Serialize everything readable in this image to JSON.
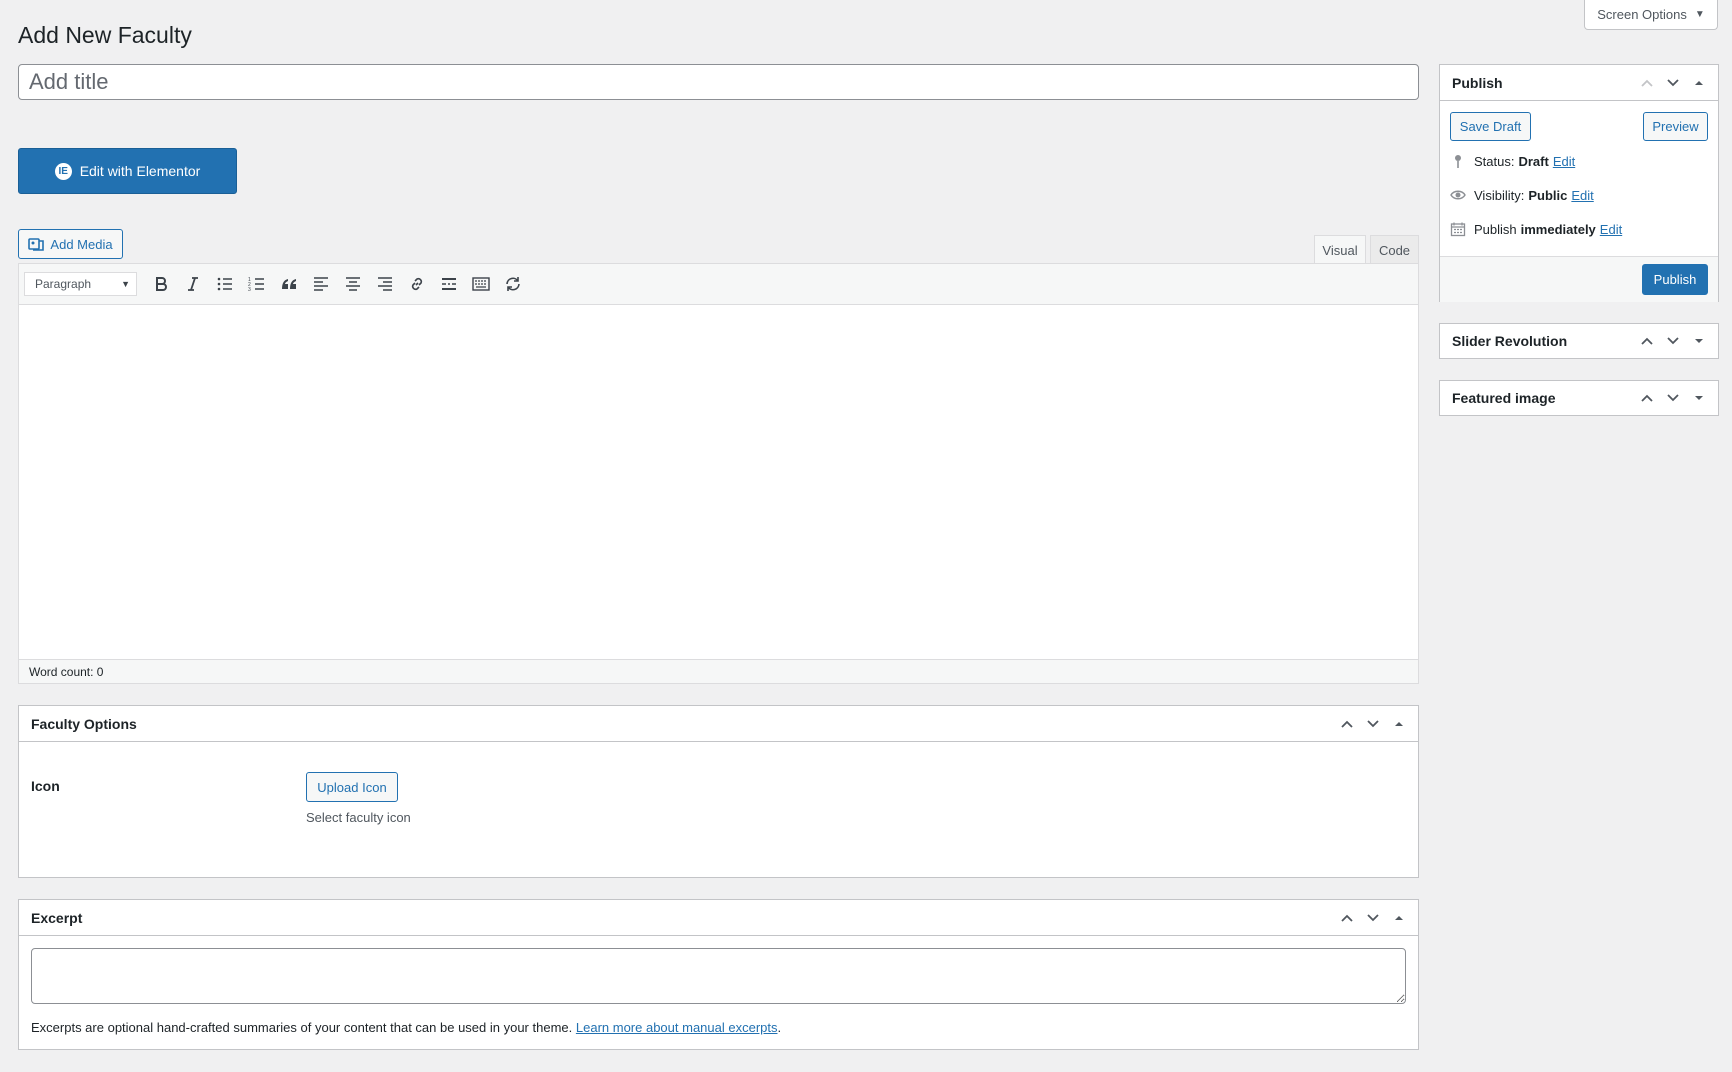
{
  "screen_options": {
    "label": "Screen Options"
  },
  "page": {
    "title": "Add New Faculty"
  },
  "title_field": {
    "placeholder": "Add title",
    "value": ""
  },
  "elementor": {
    "label": "Edit with Elementor",
    "icon": "elementor-icon"
  },
  "media": {
    "add_media_label": "Add Media"
  },
  "editor": {
    "tabs": {
      "visual": "Visual",
      "code": "Code"
    },
    "format_select": "Paragraph",
    "word_count": "Word count: 0"
  },
  "faculty_options": {
    "title": "Faculty Options",
    "icon_label": "Icon",
    "upload_button": "Upload Icon",
    "description": "Select faculty icon"
  },
  "excerpt": {
    "title": "Excerpt",
    "help_text": "Excerpts are optional hand-crafted summaries of your content that can be used in your theme.",
    "link_text": "Learn more about manual excerpts",
    "help_end": "."
  },
  "publish": {
    "title": "Publish",
    "save_draft": "Save Draft",
    "preview": "Preview",
    "status_label": "Status:",
    "status_value": "Draft",
    "visibility_label": "Visibility:",
    "visibility_value": "Public",
    "publish_label": "Publish",
    "publish_value": "immediately",
    "edit_link": "Edit",
    "publish_button": "Publish"
  },
  "slider_revolution": {
    "title": "Slider Revolution"
  },
  "featured_image": {
    "title": "Featured image"
  },
  "colors": {
    "accent": "#2271b1",
    "background": "#f0f0f1",
    "border": "#c3c4c7"
  }
}
